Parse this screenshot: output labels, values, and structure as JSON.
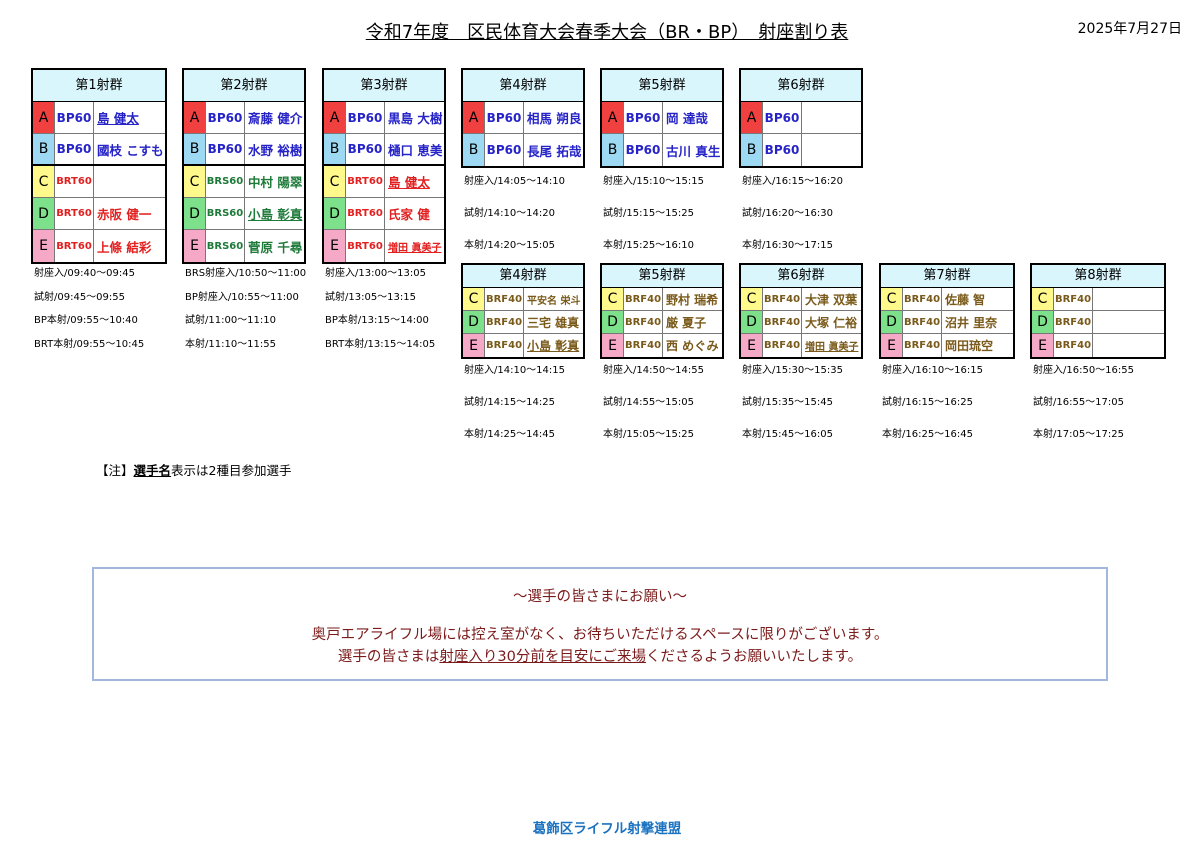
{
  "title": "令和7年度　区民体育大会春季大会（BR・BP）　射座割り表",
  "date": "2025年7月27日",
  "top_groups": [
    {
      "header": "第1射群",
      "rows": [
        {
          "letter": "A",
          "event": "BP60",
          "name": "島 健太"
        },
        {
          "letter": "B",
          "event": "BP60",
          "name": "國枝 こすも"
        },
        {
          "letter": "C",
          "event": "BRT60",
          "name": ""
        },
        {
          "letter": "D",
          "event": "BRT60",
          "name": "赤阪 健一"
        },
        {
          "letter": "E",
          "event": "BRT60",
          "name": "上條 結彩"
        }
      ],
      "schedule": [
        "射座入/09:40～09:45",
        "試射/09:45～09:55",
        "BP本射/09:55～10:40",
        "BRT本射/09:55～10:45"
      ]
    },
    {
      "header": "第2射群",
      "rows": [
        {
          "letter": "A",
          "event": "BP60",
          "name": "斎藤 健介"
        },
        {
          "letter": "B",
          "event": "BP60",
          "name": "水野 裕樹"
        },
        {
          "letter": "C",
          "event": "BRS60",
          "name": "中村 陽翠"
        },
        {
          "letter": "D",
          "event": "BRS60",
          "name": "小島 彰真"
        },
        {
          "letter": "E",
          "event": "BRS60",
          "name": "菅原 千尋"
        }
      ],
      "schedule": [
        "BRS射座入/10:50～11:00",
        "BP射座入/10:55～11:00",
        "試射/11:00～11:10",
        "本射/11:10～11:55"
      ]
    },
    {
      "header": "第3射群",
      "rows": [
        {
          "letter": "A",
          "event": "BP60",
          "name": "黒島 大樹"
        },
        {
          "letter": "B",
          "event": "BP60",
          "name": "樋口 恵美"
        },
        {
          "letter": "C",
          "event": "BRT60",
          "name": "島 健太"
        },
        {
          "letter": "D",
          "event": "BRT60",
          "name": "氏家 健"
        },
        {
          "letter": "E",
          "event": "BRT60",
          "name": "増田 眞美子"
        }
      ],
      "schedule": [
        "射座入/13:00～13:05",
        "試射/13:05～13:15",
        "BP本射/13:15～14:00",
        "BRT本射/13:15～14:05"
      ]
    }
  ],
  "bp_groups": [
    {
      "header": "第4射群",
      "rows": [
        {
          "letter": "A",
          "event": "BP60",
          "name": "相馬 朔良"
        },
        {
          "letter": "B",
          "event": "BP60",
          "name": "長尾 拓哉"
        }
      ],
      "schedule": [
        "射座入/14:05～14:10",
        "試射/14:10～14:20",
        "本射/14:20～15:05"
      ]
    },
    {
      "header": "第5射群",
      "rows": [
        {
          "letter": "A",
          "event": "BP60",
          "name": "岡 達哉"
        },
        {
          "letter": "B",
          "event": "BP60",
          "name": "古川 真生"
        }
      ],
      "schedule": [
        "射座入/15:10～15:15",
        "試射/15:15～15:25",
        "本射/15:25～16:10"
      ]
    },
    {
      "header": "第6射群",
      "rows": [
        {
          "letter": "A",
          "event": "BP60",
          "name": ""
        },
        {
          "letter": "B",
          "event": "BP60",
          "name": ""
        }
      ],
      "schedule": [
        "射座入/16:15～16:20",
        "試射/16:20～16:30",
        "本射/16:30～17:15"
      ]
    }
  ],
  "brf_groups": [
    {
      "header": "第4射群",
      "rows": [
        {
          "letter": "C",
          "event": "BRF40",
          "name": "平安名 栄斗"
        },
        {
          "letter": "D",
          "event": "BRF40",
          "name": "三宅 雄真"
        },
        {
          "letter": "E",
          "event": "BRF40",
          "name": "小島 彰真"
        }
      ],
      "schedule": [
        "射座入/14:10～14:15",
        "試射/14:15～14:25",
        "本射/14:25～14:45"
      ]
    },
    {
      "header": "第5射群",
      "rows": [
        {
          "letter": "C",
          "event": "BRF40",
          "name": "野村 瑞希"
        },
        {
          "letter": "D",
          "event": "BRF40",
          "name": "厳 夏子"
        },
        {
          "letter": "E",
          "event": "BRF40",
          "name": "西 めぐみ"
        }
      ],
      "schedule": [
        "射座入/14:50～14:55",
        "試射/14:55～15:05",
        "本射/15:05～15:25"
      ]
    },
    {
      "header": "第6射群",
      "rows": [
        {
          "letter": "C",
          "event": "BRF40",
          "name": "大津 双葉"
        },
        {
          "letter": "D",
          "event": "BRF40",
          "name": "大塚 仁裕"
        },
        {
          "letter": "E",
          "event": "BRF40",
          "name": "増田 眞美子"
        }
      ],
      "schedule": [
        "射座入/15:30～15:35",
        "試射/15:35～15:45",
        "本射/15:45～16:05"
      ]
    },
    {
      "header": "第7射群",
      "rows": [
        {
          "letter": "C",
          "event": "BRF40",
          "name": "佐藤 智"
        },
        {
          "letter": "D",
          "event": "BRF40",
          "name": "沼井 里奈"
        },
        {
          "letter": "E",
          "event": "BRF40",
          "name": "岡田琉空"
        }
      ],
      "schedule": [
        "射座入/16:10～16:15",
        "試射/16:15～16:25",
        "本射/16:25～16:45"
      ]
    },
    {
      "header": "第8射群",
      "rows": [
        {
          "letter": "C",
          "event": "BRF40",
          "name": ""
        },
        {
          "letter": "D",
          "event": "BRF40",
          "name": ""
        },
        {
          "letter": "E",
          "event": "BRF40",
          "name": ""
        }
      ],
      "schedule": [
        "射座入/16:50～16:55",
        "試射/16:55～17:05",
        "本射/17:05～17:25"
      ]
    }
  ],
  "note": {
    "prefix": "【注】",
    "underlined": "選手名",
    "rest": "表示は2種目参加選手"
  },
  "notice": {
    "heading": "～選手の皆さまにお願い～",
    "line1": "奥戸エアライフル場には控え室がなく、お待ちいただけるスペースに限りがございます。",
    "line2_pre": "選手の皆さまは",
    "line2_ul": "射座入り30分前を目安にご来場",
    "line2_post": "くださるようお願いいたします。"
  },
  "footer": "葛飾区ライフル射撃連盟"
}
